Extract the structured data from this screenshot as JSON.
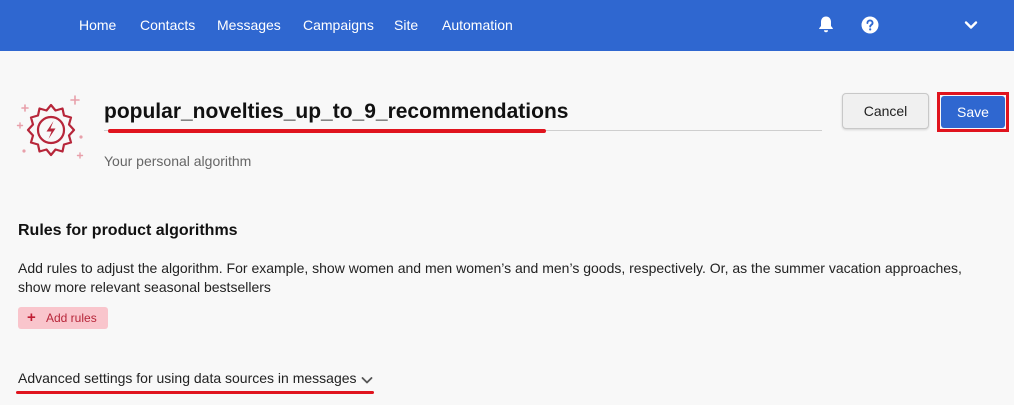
{
  "nav": {
    "items": [
      "Home",
      "Contacts",
      "Messages",
      "Campaigns",
      "Site",
      "Automation"
    ],
    "icons": [
      "bell-icon",
      "help-icon",
      "chevron-down-icon"
    ],
    "color": "#2f67d0"
  },
  "header": {
    "title": "popular_novelties_up_to_9_recommendations",
    "subtitle": "Your personal algorithm",
    "icon": "lightning-badge-icon",
    "cancel_label": "Cancel",
    "save_label": "Save"
  },
  "rules": {
    "heading": "Rules for product algorithms",
    "description": "Add rules to adjust the algorithm. For example, show women and men women’s and men’s goods, respectively. Or, as the summer vacation approaches, show more relevant seasonal bestsellers",
    "add_label": "Add rules"
  },
  "advanced": {
    "label": "Advanced settings for using data sources in messages"
  },
  "colors": {
    "accent": "#2f67d0",
    "highlight": "#e0141e",
    "add_button_bg": "#f9c5cc",
    "icon": "#b7263a"
  }
}
